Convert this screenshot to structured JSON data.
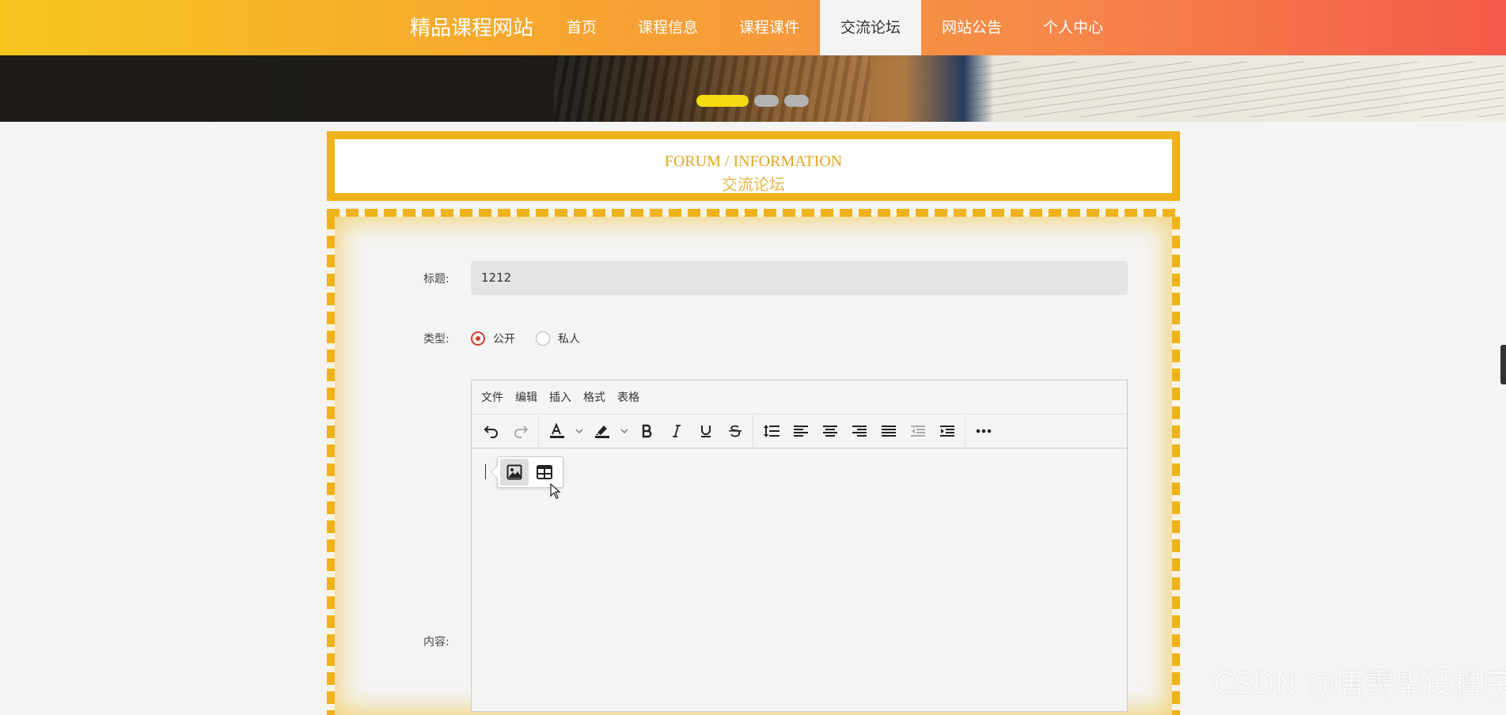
{
  "nav": {
    "brand": "精品课程网站",
    "items": [
      {
        "label": "首页"
      },
      {
        "label": "课程信息"
      },
      {
        "label": "课程课件"
      },
      {
        "label": "交流论坛",
        "active": true
      },
      {
        "label": "网站公告"
      },
      {
        "label": "个人中心"
      }
    ]
  },
  "banner": {
    "slides": 3,
    "active_slide": 1
  },
  "section": {
    "title_en": "FORUM / INFORMATION",
    "title_cn": "交流论坛"
  },
  "form": {
    "title_label": "标题:",
    "title_value": "1212",
    "type_label": "类型:",
    "type_options": [
      {
        "label": "公开",
        "checked": true
      },
      {
        "label": "私人",
        "checked": false
      }
    ],
    "content_label": "内容:"
  },
  "editor": {
    "menu": [
      "文件",
      "编辑",
      "插入",
      "格式",
      "表格"
    ],
    "toolbar_icons": [
      "undo-icon",
      "redo-icon",
      "text-color-icon",
      "highlight-color-icon",
      "bold-icon",
      "italic-icon",
      "underline-icon",
      "strikethrough-icon",
      "line-height-icon",
      "align-left-icon",
      "align-center-icon",
      "align-right-icon",
      "align-justify-icon",
      "outdent-icon",
      "indent-icon",
      "more-icon"
    ],
    "quickbar_icons": [
      "image-icon",
      "table-icon"
    ]
  },
  "watermark": "CSDN @唐雯毕设程序",
  "colors": {
    "accent": "#efb21a",
    "nav_gradient_start": "#f6c61f",
    "nav_gradient_end": "#f5594a",
    "radio_checked": "#d23b2e"
  }
}
